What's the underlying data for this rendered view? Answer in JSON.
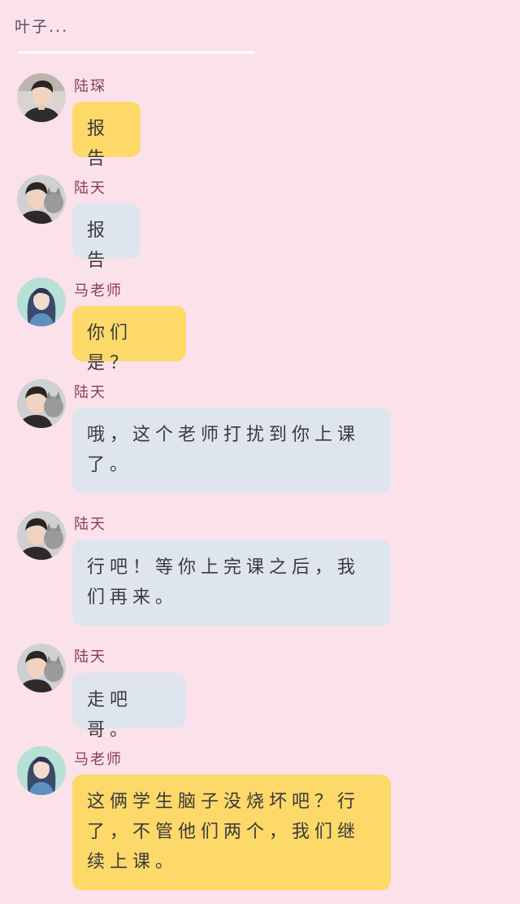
{
  "header": {
    "title": "叶子..."
  },
  "colors": {
    "background": "#fbe1ea",
    "bubble_teacher": "#fdd96a",
    "bubble_student": "#dfe5ee",
    "name_color": "#8a3a5c"
  },
  "messages": [
    {
      "sender": "陆琛",
      "avatar": "boy-avatar",
      "bubble": "yellow",
      "text": "报告"
    },
    {
      "sender": "陆天",
      "avatar": "boy-cat-avatar",
      "bubble": "gray",
      "text": "报告"
    },
    {
      "sender": "马老师",
      "avatar": "girl-avatar",
      "bubble": "yellow",
      "text": "你们是？"
    },
    {
      "sender": "陆天",
      "avatar": "boy-cat-avatar",
      "bubble": "gray",
      "text": "哦，这个老师打扰到你上课了。"
    },
    {
      "sender": "陆天",
      "avatar": "boy-cat-avatar",
      "bubble": "gray",
      "text": "行吧！等你上完课之后，我们再来。"
    },
    {
      "sender": "陆天",
      "avatar": "boy-cat-avatar",
      "bubble": "gray",
      "text": "走吧哥。"
    },
    {
      "sender": "马老师",
      "avatar": "girl-avatar",
      "bubble": "yellow",
      "text": "这俩学生脑子没烧坏吧？行了，不管他们两个，我们继续上课。"
    }
  ]
}
